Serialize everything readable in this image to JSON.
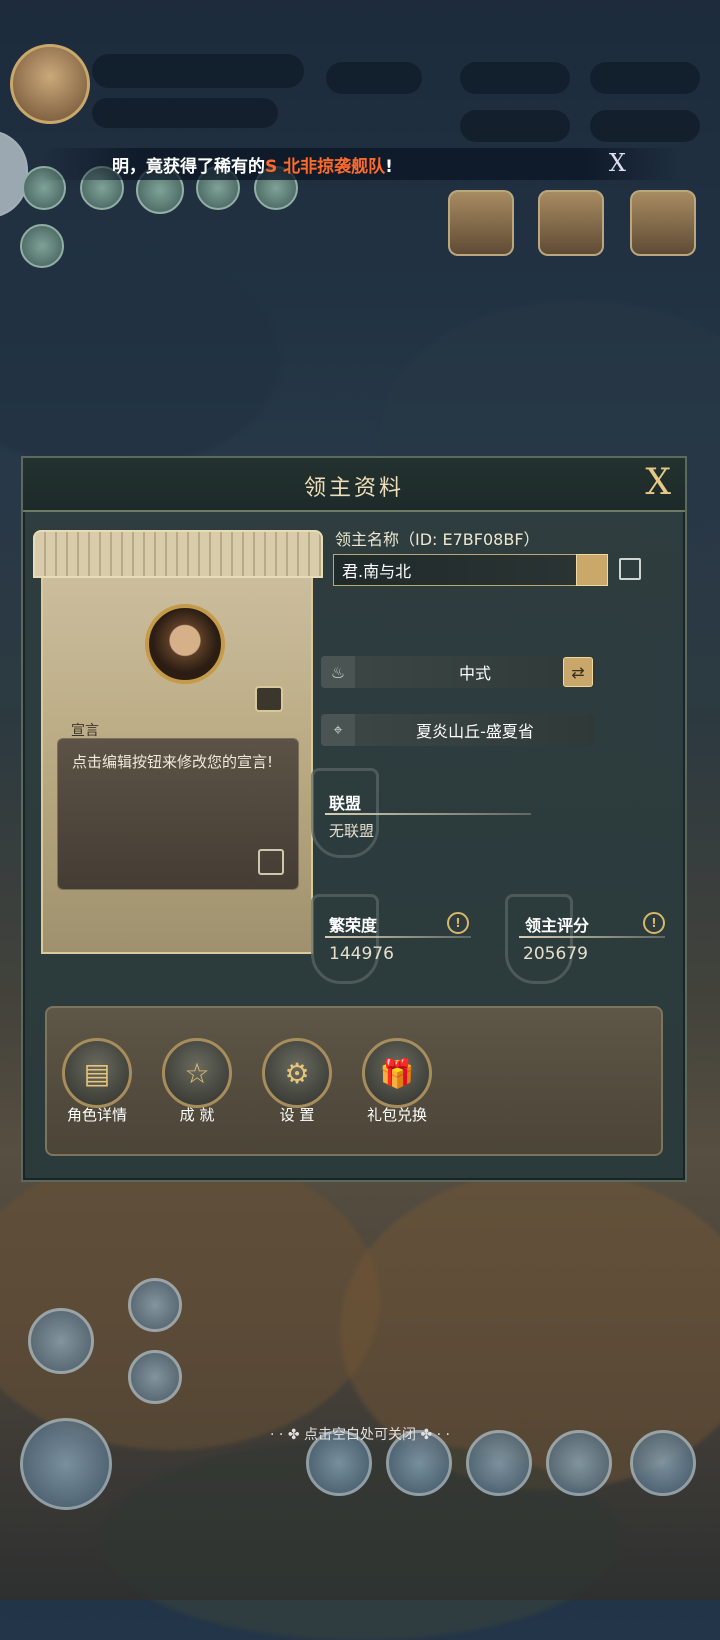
{
  "hud": {
    "ticker": {
      "prefix": "明，竟获得了稀有的",
      "highlight": "S 北非掠袭舰队",
      "suffix": "!"
    },
    "ticker_close": "X"
  },
  "dialog": {
    "title": "领主资料",
    "close": "X",
    "portrait": {
      "declaration_label": "宣言",
      "declaration_text": "点击编辑按钮来修改您的宣言!"
    },
    "lord": {
      "name_label": "领主名称（ID: E7BF08BF）",
      "name_value": "君.南与北",
      "style_value": "中式",
      "location_value": "夏炎山丘-盛夏省"
    },
    "alliance": {
      "label": "联盟",
      "value": "无联盟"
    },
    "prosperity": {
      "label": "繁荣度",
      "value": "144976"
    },
    "lord_score": {
      "label": "领主评分",
      "value": "205679"
    },
    "actions": [
      {
        "label": "角色详情",
        "icon": "book-icon"
      },
      {
        "label": "成 就",
        "icon": "star-icon"
      },
      {
        "label": "设 置",
        "icon": "gear-icon"
      },
      {
        "label": "礼包兑换",
        "icon": "gift-icon"
      }
    ]
  },
  "footer": {
    "tap_to_close": "点击空白处可关闭"
  }
}
